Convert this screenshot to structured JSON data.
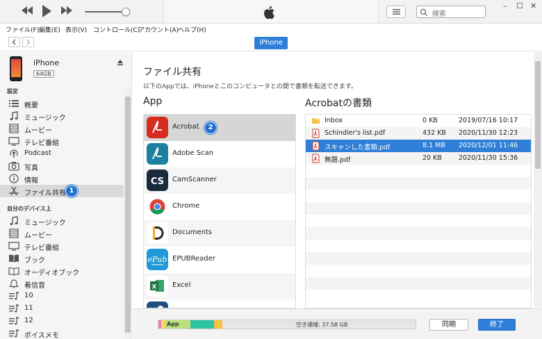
{
  "window": {
    "search_placeholder": "検索",
    "controls": [
      "–",
      "☐",
      "✕"
    ]
  },
  "menu": [
    "ファイル(F)",
    "編集(E)",
    "表示(V)",
    "コントロール(C)",
    "アカウント(A)",
    "ヘルプ(H)"
  ],
  "nav": {
    "device_tab": "iPhone"
  },
  "device": {
    "name": "iPhone",
    "capacity": "64GB"
  },
  "sidebar": {
    "settings_header": "設定",
    "settings": [
      "概要",
      "ミュージック",
      "ムービー",
      "テレビ番組",
      "Podcast",
      "写真",
      "情報",
      "ファイル共有"
    ],
    "mydevice_header": "自分のデバイス上",
    "mydevice": [
      "ミュージック",
      "ムービー",
      "テレビ番組",
      "ブック",
      "オーディオブック",
      "着信音",
      "10",
      "11",
      "12",
      "ボイスメモ"
    ]
  },
  "main": {
    "title": "ファイル共有",
    "description": "以下のAppでは、iPhoneとこのコンピュータとの間で書類を転送できます。",
    "apps_header": "App",
    "docs_header": "Acrobatの書類",
    "apps": [
      "Acrobat",
      "Adobe Scan",
      "CamScanner",
      "Chrome",
      "Documents",
      "EPUBReader",
      "Excel"
    ],
    "files": [
      {
        "name": "Inbox",
        "size": "0 KB",
        "date": "2019/07/16 10:17",
        "type": "folder"
      },
      {
        "name": "Schindler's list.pdf",
        "size": "432 KB",
        "date": "2020/11/30 12:23",
        "type": "pdf"
      },
      {
        "name": "スキャンした書類.pdf",
        "size": "8.1 MB",
        "date": "2020/12/01 11:46",
        "type": "pdf"
      },
      {
        "name": "無題.pdf",
        "size": "20 KB",
        "date": "2020/11/30 15:36",
        "type": "pdf"
      }
    ]
  },
  "badges": [
    "1",
    "2"
  ],
  "capacity": {
    "app_label": "App",
    "free_label": "空き領域: 37.58 GB"
  },
  "buttons": {
    "sync": "同期",
    "done": "終了"
  },
  "colors": {
    "accent": "#2f7fd8",
    "acrobat": "#d62b1f",
    "adobe_scan": "#1d80a0",
    "camscanner": "#1a2b3c",
    "excel": "#1f7244"
  }
}
